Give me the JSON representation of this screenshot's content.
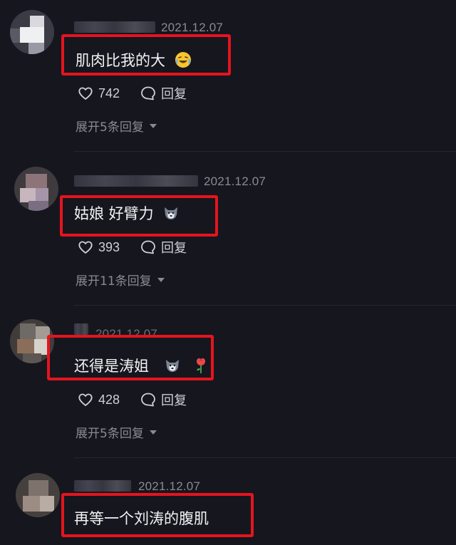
{
  "comments": [
    {
      "date": "2021.12.07",
      "text": "肌肉比我的大",
      "emoji": "laughing-tears-emoji",
      "likes": "742",
      "reply_label": "回复",
      "expand_label": "展开5条回复"
    },
    {
      "date": "2021.12.07",
      "text": "姑娘 好臂力",
      "emoji": "husky-emoji",
      "likes": "393",
      "reply_label": "回复",
      "expand_label": "展开11条回复"
    },
    {
      "date": "2021.12.07",
      "text": "还得是涛姐",
      "emoji": "husky-emoji rose-emoji",
      "likes": "428",
      "reply_label": "回复",
      "expand_label": "展开5条回复"
    },
    {
      "date": "2021.12.07",
      "text": "再等一个刘涛的腹肌"
    }
  ],
  "colors": {
    "background": "#16161e",
    "highlight": "#e5141e",
    "secondary_text": "#8a8a94"
  }
}
